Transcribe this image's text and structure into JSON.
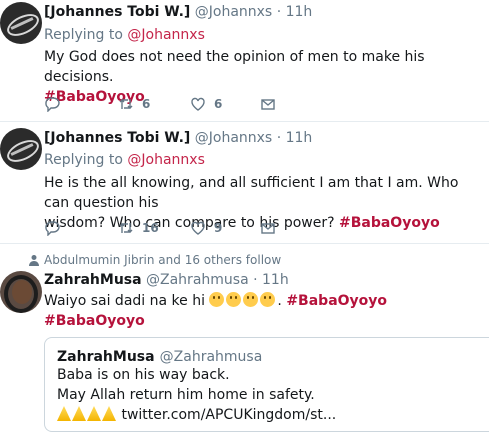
{
  "tweets": [
    {
      "name": "[Johannes Tobi W.]",
      "handle": "@Johannxs",
      "dot": "·",
      "time": "11h",
      "replying_prefix": "Replying to",
      "replying_to": "@Johannxs",
      "text": "My God does not need the opinion of men to make his decisions.",
      "hashtag": "#BabaOyoyo",
      "retweets": "6",
      "likes": "6"
    },
    {
      "name": "[Johannes Tobi W.]",
      "handle": "@Johannxs",
      "dot": "·",
      "time": "11h",
      "replying_prefix": "Replying to",
      "replying_to": "@Johannxs",
      "text_line1": "He is the all knowing, and all sufficient I am that I am. Who can question his",
      "text_line2": "wisdom? Who can compare to his power?",
      "hashtag": "#BabaOyoyo",
      "retweets": "16",
      "likes": "9"
    },
    {
      "social_context": "Abdulmumin Jibrin and 16 others follow",
      "name": "ZahrahMusa",
      "handle": "@Zahrahmusa",
      "dot": "·",
      "time": "11h",
      "text": "Waiyo sai dadi na ke hi",
      "hashtag_inline": "#BabaOyoyo",
      "hashtag": "#BabaOyoyo",
      "quote": {
        "name": "ZahrahMusa",
        "handle": "@Zahrahmusa",
        "line1": "Baba is on his way back.",
        "line2": "May Allah return him home in safety.",
        "link": "twitter.com/APCUKingdom/st..."
      }
    }
  ],
  "colors": {
    "hashtag": "#b5123b",
    "secondary_text": "#657786",
    "divider": "#e6ecf0"
  },
  "icons": [
    "reply-icon",
    "retweet-icon",
    "like-icon",
    "direct-message-icon",
    "follow-context-icon"
  ]
}
